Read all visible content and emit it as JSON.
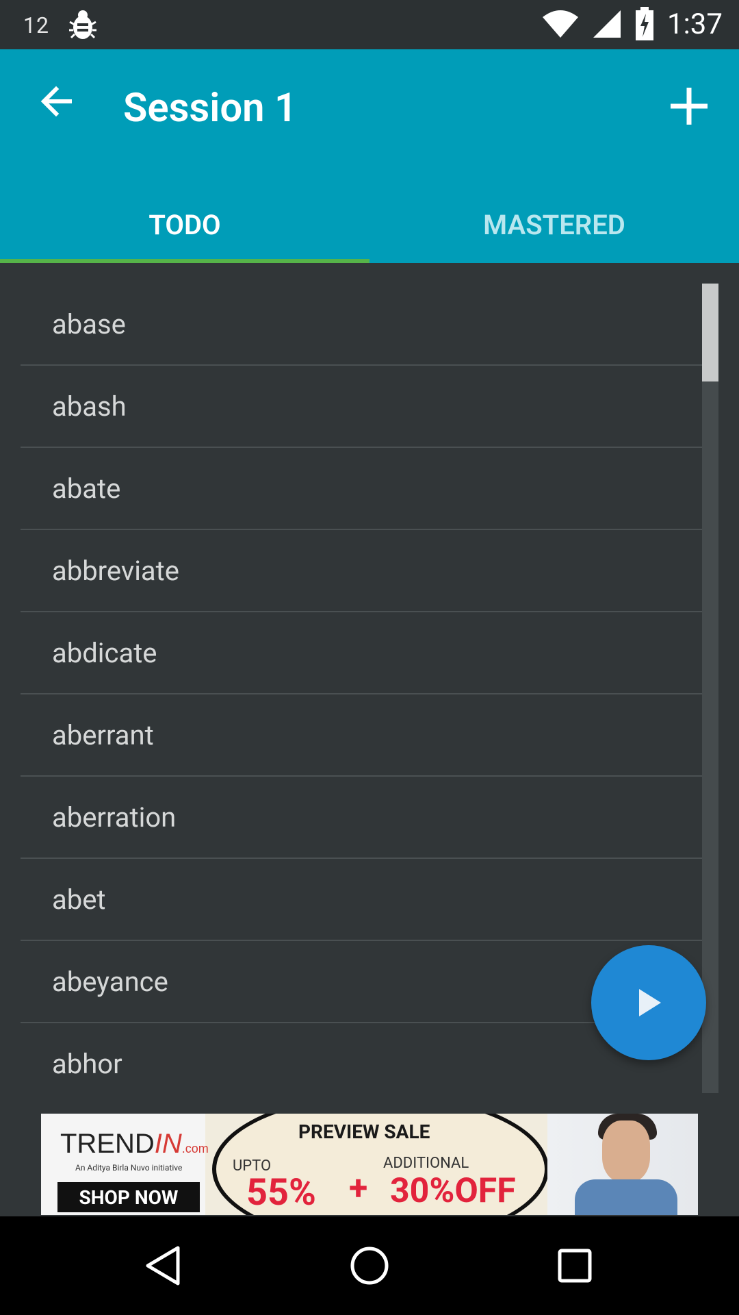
{
  "status_bar": {
    "sim_label": "12",
    "time": "1:37"
  },
  "app_bar": {
    "title": "Session 1"
  },
  "tabs": [
    {
      "label": "TODO",
      "selected": true
    },
    {
      "label": "MASTERED",
      "selected": false
    }
  ],
  "words": [
    "abase",
    "abash",
    "abate",
    "abbreviate",
    "abdicate",
    "aberrant",
    "aberration",
    "abet",
    "abeyance",
    "abhor"
  ],
  "ad": {
    "brand_main": "TREND",
    "brand_accent": "IN",
    "brand_suffix": ".com",
    "tagline": "An Aditya Birla Nuvo initiative",
    "shop_now": "SHOP NOW",
    "preview_sale": "PREVIEW SALE",
    "upto": "UPTO",
    "additional": "ADDITIONAL",
    "discount_1": "55%",
    "plus": "+",
    "discount_2": "30%OFF"
  },
  "colors": {
    "app_bar": "#009db8",
    "tab_indicator": "#56b449",
    "fab": "#1f88d4",
    "background": "#313638"
  }
}
